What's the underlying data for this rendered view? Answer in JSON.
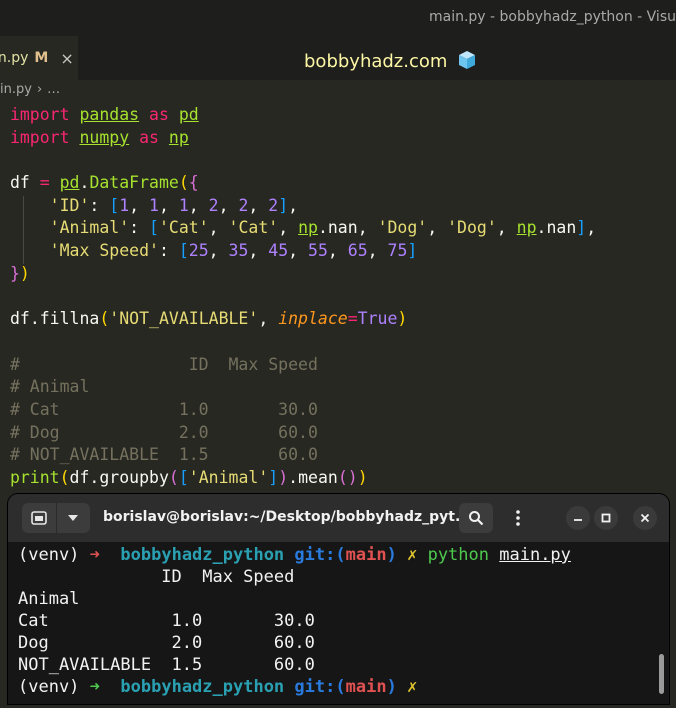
{
  "window_title": "main.py - bobbyhadz_python - Visu",
  "tab": {
    "name": "in.py",
    "modified": "M",
    "close": "×"
  },
  "watermark": "bobbyhadz.com",
  "breadcrumb": {
    "file": "in.py",
    "sep": "›",
    "more": "…"
  },
  "code": {
    "import_kw": "import",
    "as_kw": "as",
    "pandas": "pandas",
    "pd": "pd",
    "numpy": "numpy",
    "np": "np",
    "df": "df",
    "eq": " = ",
    "dataframe": "DataFrame",
    "id_key": "'ID'",
    "animal_key": "'Animal'",
    "speed_key": "'Max Speed'",
    "n1": "1",
    "n2": "2",
    "n25": "25",
    "n35": "35",
    "n45": "45",
    "n55": "55",
    "n65": "65",
    "n75": "75",
    "cat": "'Cat'",
    "dog": "'Dog'",
    "nan": "nan",
    "fillna": "fillna",
    "not_available": "'NOT_AVAILABLE'",
    "inplace": "inplace",
    "true_kw": "True",
    "comment1": "#                 ID  Max Speed",
    "comment2": "# Animal",
    "comment3": "# Cat            1.0       30.0",
    "comment4": "# Dog            2.0       60.0",
    "comment5": "# NOT_AVAILABLE  1.5       60.0",
    "print": "print",
    "groupby": "groupby",
    "mean": "mean"
  },
  "terminal": {
    "title": "borislav@borislav:~/Desktop/bobbyhadz_pyt...",
    "venv": "(venv)",
    "arrow": "➜",
    "dir": "bobbyhadz_python",
    "git": "git:",
    "paren_open": "(",
    "branch": "main",
    "paren_close": ")",
    "x": "✗",
    "cmd": "python",
    "arg": "main.py",
    "out1": "              ID  Max Speed",
    "out2": "Animal",
    "out3": "Cat            1.0       30.0",
    "out4": "Dog            2.0       60.0",
    "out5": "NOT_AVAILABLE  1.5       60.0"
  }
}
